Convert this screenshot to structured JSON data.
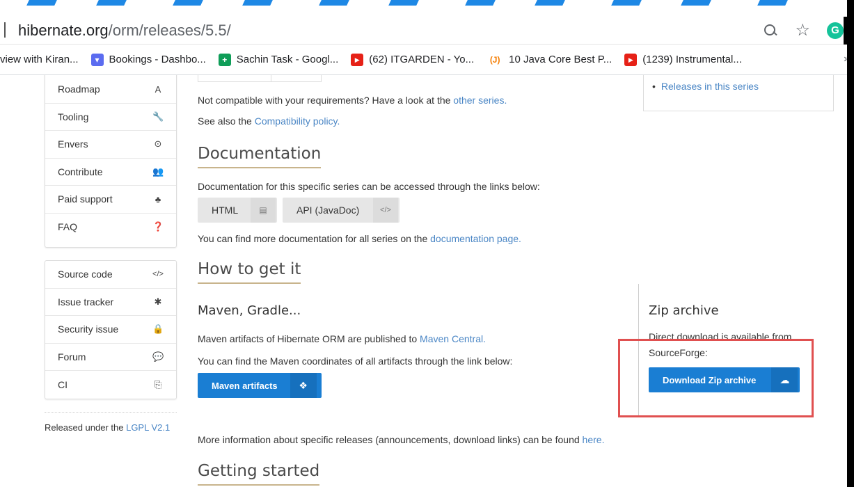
{
  "browser": {
    "url_host": "hibernate.org",
    "url_path": "/orm/releases/5.5/",
    "zoom_icon": "zoom-icon",
    "bookmark_icon": "star-icon",
    "extension_label": "G",
    "bookmarks": [
      {
        "label": "view with Kiran...",
        "icon": "none",
        "color": ""
      },
      {
        "label": "Bookings - Dashbo...",
        "icon": "calendar",
        "color": "#5b6cf0",
        "glyph": "▾"
      },
      {
        "label": "Sachin Task - Googl...",
        "icon": "sheets",
        "color": "#0f9d58",
        "glyph": "+"
      },
      {
        "label": "(62) ITGARDEN - Yo...",
        "icon": "youtube",
        "color": "#e62117",
        "glyph": "▶"
      },
      {
        "label": "10 Java Core Best P...",
        "icon": "j",
        "color": "#ffffff",
        "glyph": "(J)"
      },
      {
        "label": "(1239) Instrumental...",
        "icon": "youtube",
        "color": "#e62117",
        "glyph": "▶"
      }
    ],
    "more": "»"
  },
  "sidebar": {
    "top_items": [
      {
        "label": "Roadmap",
        "icon": "A"
      },
      {
        "label": "Tooling",
        "icon": "🔧"
      },
      {
        "label": "Envers",
        "icon": "⊙"
      },
      {
        "label": "Contribute",
        "icon": "👥"
      },
      {
        "label": "Paid support",
        "icon": "♣"
      },
      {
        "label": "FAQ",
        "icon": "❓"
      }
    ],
    "bottom_items": [
      {
        "label": "Source code",
        "icon": "</>"
      },
      {
        "label": "Issue tracker",
        "icon": "✱"
      },
      {
        "label": "Security issue",
        "icon": "🔒"
      },
      {
        "label": "Forum",
        "icon": "💬"
      },
      {
        "label": "CI",
        "icon": "⎘"
      }
    ],
    "license_prefix": "Released under the ",
    "license_link": "LGPL V2.1"
  },
  "main": {
    "compat_text": "Not compatible with your requirements? Have a look at the ",
    "compat_link": "other series.",
    "see_also_text": "See also the ",
    "see_also_link": "Compatibility policy.",
    "doc_heading": "Documentation",
    "doc_text": "Documentation for this specific series can be accessed through the links below:",
    "html_button": "HTML",
    "api_button": "API (JavaDoc)",
    "more_doc_text": "You can find more documentation for all series on the ",
    "more_doc_link": "documentation page.",
    "get_heading": "How to get it",
    "maven_heading": "Maven, Gradle...",
    "maven_text": "Maven artifacts of Hibernate ORM are published to ",
    "maven_link": "Maven Central.",
    "coords_text": "You can find the Maven coordinates of all artifacts through the link below:",
    "maven_button": "Maven artifacts",
    "releases_text": "More information about specific releases (announcements, download links) can be found ",
    "releases_link": "here.",
    "started_heading": "Getting started"
  },
  "right_panel": {
    "releases_link": "Releases in this series",
    "zip_heading": "Zip archive",
    "zip_text1": "Direct download is available from",
    "zip_text2": "SourceForge:",
    "zip_button": "Download Zip archive"
  },
  "colors": {
    "link": "#4a86c5",
    "primary_button": "#1a7ed3",
    "heading_underline": "#c8b48c",
    "highlight": "#e05050"
  }
}
